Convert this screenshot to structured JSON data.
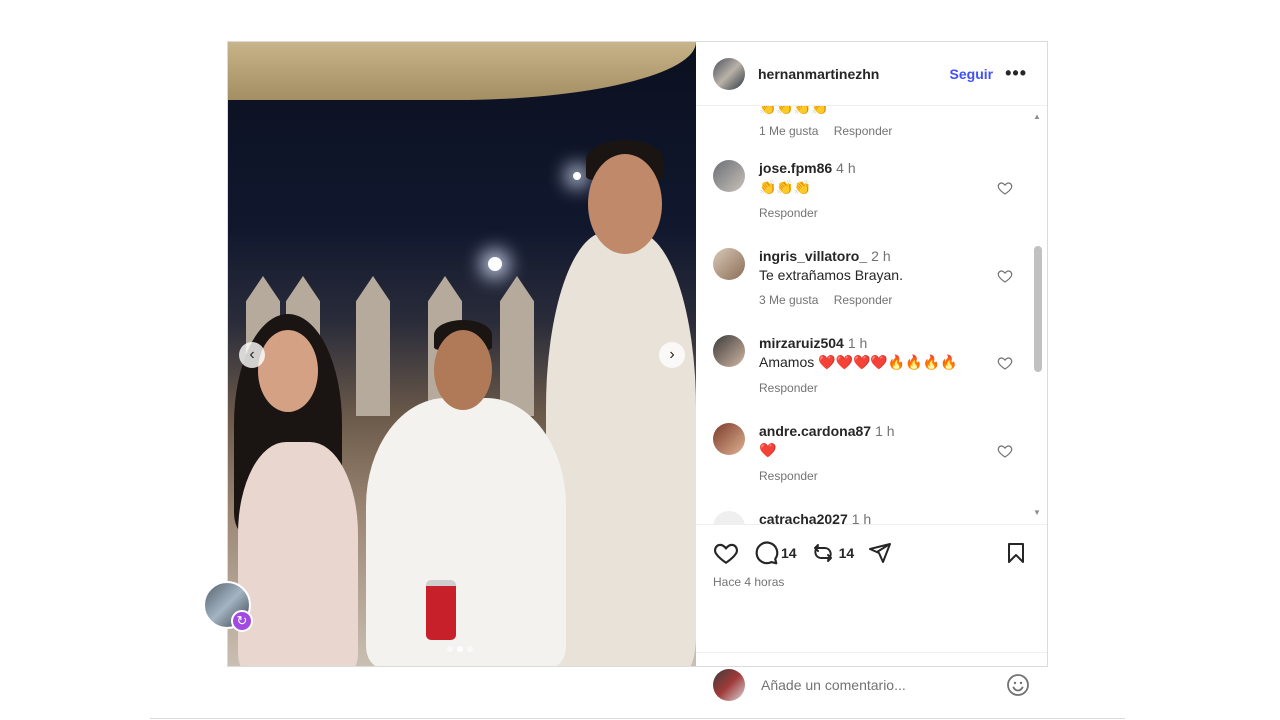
{
  "post": {
    "author": "hernanmartinezhn",
    "follow_label": "Seguir",
    "more_label": "•••",
    "photo_alt": "",
    "carousel": {
      "prev_icon": "chevron-left-icon",
      "next_icon": "chevron-right-icon",
      "dots": 3,
      "active_dot": 1
    }
  },
  "comments": {
    "partial_top": {
      "text": "👏👏👏👏",
      "likes": "1 Me gusta",
      "reply": "Responder"
    },
    "items": [
      {
        "user": "jose.fpm86",
        "time": "4 h",
        "text": "👏👏👏",
        "likes": "",
        "reply": "Responder"
      },
      {
        "user": "ingris_villatoro_",
        "time": "2 h",
        "text": "Te extrañamos Brayan.",
        "likes": "3 Me gusta",
        "reply": "Responder"
      },
      {
        "user": "mirzaruiz504",
        "time": "1 h",
        "text": "Amamos ❤️❤️❤️❤️🔥🔥🔥🔥",
        "likes": "",
        "reply": "Responder"
      },
      {
        "user": "andre.cardona87",
        "time": "1 h",
        "text": "❤️",
        "likes": "",
        "reply": "Responder"
      },
      {
        "user": "catracha2027",
        "time": "1 h",
        "text": "",
        "likes": "",
        "reply": ""
      }
    ]
  },
  "actions": {
    "comment_count": "14",
    "repost_count": "14",
    "time_ago": "Hace 4 horas"
  },
  "add_comment": {
    "placeholder": "Añade un comentario..."
  },
  "colors": {
    "link": "#4150f7",
    "muted": "#737373",
    "border": "#dbdbdb",
    "heart_red": "#e0245e"
  }
}
